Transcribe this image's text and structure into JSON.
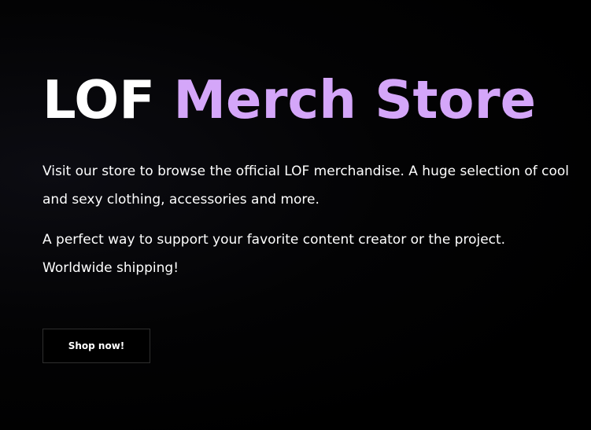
{
  "hero": {
    "title_main": "LOF",
    "title_accent": "Merch Store",
    "paragraph_1": "Visit our store to browse the official LOF merchandise. A huge selection of cool and sexy clothing, accessories and more.",
    "paragraph_2": "A perfect way to support your favorite content creator or the project. Worldwide shipping!",
    "button_label": "Shop now!"
  },
  "colors": {
    "background": "#000000",
    "text": "#ffffff",
    "accent": "#d4a6f9",
    "button_border": "#2e2e2e"
  }
}
